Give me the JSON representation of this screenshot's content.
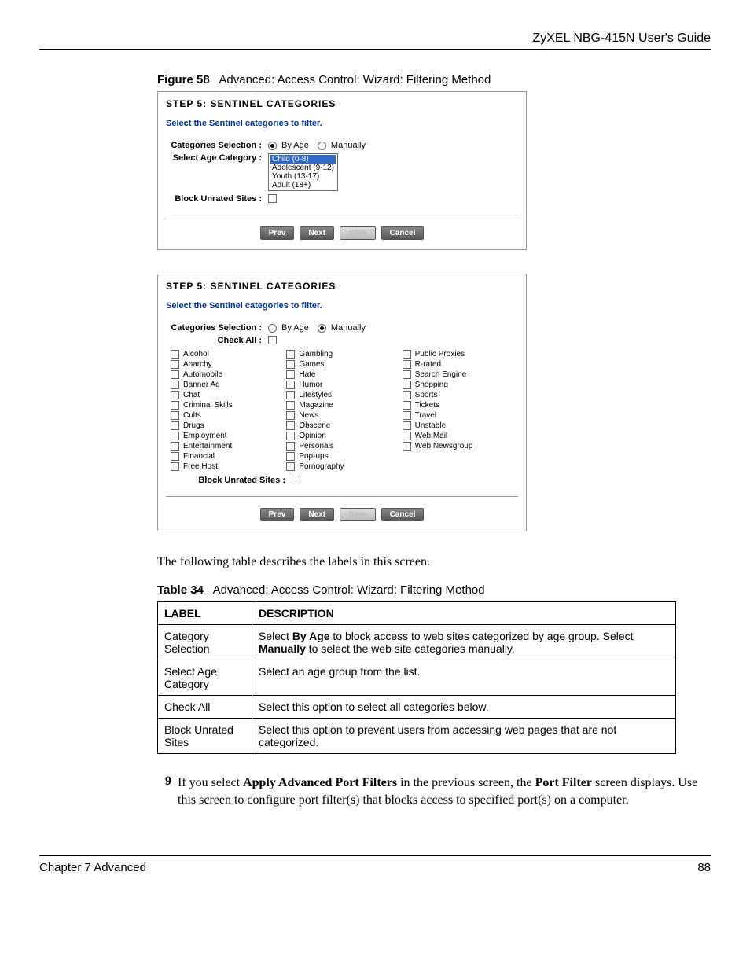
{
  "header": {
    "title": "ZyXEL NBG-415N User's Guide"
  },
  "figure": {
    "label": "Figure 58",
    "title": "Advanced: Access Control: Wizard: Filtering Method"
  },
  "panel1": {
    "step_title": "STEP 5: SENTINEL CATEGORIES",
    "subtitle": "Select the Sentinel categories to filter.",
    "labels": {
      "cat_sel": "Categories Selection :",
      "age_cat": "Select Age Category :",
      "block_unrated": "Block Unrated Sites :"
    },
    "radios": {
      "by_age": "By Age",
      "manually": "Manually"
    },
    "age_options": [
      "Child (0-8)",
      "Adolescent (9-12)",
      "Youth (13-17)",
      "Adult (18+)"
    ],
    "buttons": {
      "prev": "Prev",
      "next": "Next",
      "save": "Save",
      "cancel": "Cancel"
    }
  },
  "panel2": {
    "step_title": "STEP 5: SENTINEL CATEGORIES",
    "subtitle": "Select the Sentinel categories to filter.",
    "labels": {
      "cat_sel": "Categories Selection :",
      "check_all": "Check All :",
      "block_unrated": "Block Unrated Sites :"
    },
    "radios": {
      "by_age": "By Age",
      "manually": "Manually"
    },
    "categories_col1": [
      "Alcohol",
      "Anarchy",
      "Automobile",
      "Banner Ad",
      "Chat",
      "Criminal Skills",
      "Cults",
      "Drugs",
      "Employment",
      "Entertainment",
      "Financial",
      "Free Host"
    ],
    "categories_col2": [
      "Gambling",
      "Games",
      "Hate",
      "Humor",
      "Lifestyles",
      "Magazine",
      "News",
      "Obscene",
      "Opinion",
      "Personals",
      "Pop-ups",
      "Pornography"
    ],
    "categories_col3": [
      "Public Proxies",
      "R-rated",
      "Search Engine",
      "Shopping",
      "Sports",
      "Tickets",
      "Travel",
      "Unstable",
      "Web Mail",
      "Web Newsgroup"
    ],
    "buttons": {
      "prev": "Prev",
      "next": "Next",
      "save": "Save",
      "cancel": "Cancel"
    }
  },
  "body_text": "The following table describes the labels in this screen.",
  "table": {
    "label": "Table 34",
    "title": "Advanced: Access Control: Wizard: Filtering Method",
    "headers": {
      "label": "LABEL",
      "desc": "DESCRIPTION"
    },
    "rows": [
      {
        "label": "Category Selection",
        "desc_parts": [
          "Select ",
          "By Age",
          " to block access to web sites categorized by age group. Select ",
          "Manually",
          " to select the web site categories manually."
        ]
      },
      {
        "label": "Select Age Category",
        "desc": "Select an age group from the list."
      },
      {
        "label": "Check All",
        "desc": "Select this option to select all categories below."
      },
      {
        "label": "Block Unrated Sites",
        "desc": "Select this option to prevent users from accessing web pages that are not categorized."
      }
    ]
  },
  "step9": {
    "num": "9",
    "parts": [
      "If you select ",
      "Apply Advanced Port Filters",
      " in the previous screen, the ",
      "Port Filter",
      " screen displays. Use this screen to configure port filter(s) that blocks access to specified port(s) on a computer."
    ]
  },
  "footer": {
    "chapter": "Chapter 7 Advanced",
    "page": "88"
  }
}
